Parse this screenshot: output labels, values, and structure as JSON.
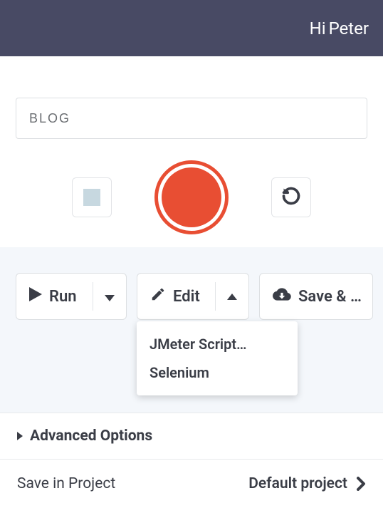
{
  "header": {
    "greeting": "Hi ",
    "username": "Peter"
  },
  "inputs": {
    "name_value": "BLOG"
  },
  "actions": {
    "run_label": "Run",
    "edit_label": "Edit",
    "save_label": "Save & Run"
  },
  "edit_menu": {
    "items": [
      "JMeter Script…",
      "Selenium"
    ]
  },
  "advanced": {
    "label": "Advanced Options"
  },
  "project": {
    "label": "Save in Project",
    "value": "Default project"
  }
}
